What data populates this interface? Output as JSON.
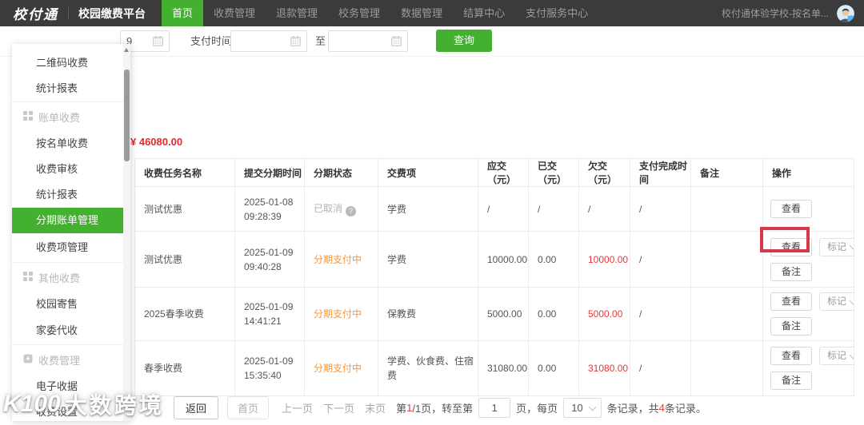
{
  "header": {
    "logo": "校付通",
    "title": "校园缴费平台",
    "nav": [
      {
        "label": "首页",
        "active": true
      },
      {
        "label": "收费管理"
      },
      {
        "label": "退款管理"
      },
      {
        "label": "校务管理"
      },
      {
        "label": "数据管理"
      },
      {
        "label": "结算中心"
      },
      {
        "label": "支付服务中心"
      }
    ],
    "school": "校付通体验学校-按名单..."
  },
  "sidebar": {
    "items": [
      {
        "label": "二维码收费",
        "type": "link"
      },
      {
        "label": "统计报表",
        "type": "link"
      },
      {
        "label": "账单收费",
        "type": "section"
      },
      {
        "label": "按名单收费",
        "type": "link"
      },
      {
        "label": "收费审核",
        "type": "link"
      },
      {
        "label": "统计报表",
        "type": "link"
      },
      {
        "label": "分期账单管理",
        "type": "link",
        "active": true
      },
      {
        "label": "收费项管理",
        "type": "link"
      },
      {
        "label": "其他收费",
        "type": "section"
      },
      {
        "label": "校园寄售",
        "type": "link"
      },
      {
        "label": "家委代收",
        "type": "link"
      },
      {
        "label": "收费管理",
        "type": "section"
      },
      {
        "label": "电子收据",
        "type": "link"
      },
      {
        "label": "收费设置",
        "type": "link"
      }
    ]
  },
  "filters": {
    "truncated_date_value": "9",
    "pay_time_label": "支付时间",
    "range_separator": "至",
    "query_button": "查询"
  },
  "summary": {
    "total_amount": "¥ 46080.00"
  },
  "table": {
    "columns": [
      "收费任务名称",
      "提交分期时间",
      "分期状态",
      "交费项",
      "应交（元）",
      "已交（元）",
      "欠交（元）",
      "支付完成时间",
      "备注",
      "操作"
    ],
    "rows": [
      {
        "name": "测试优惠",
        "submit_time": "2025-01-08 09:28:39",
        "status": "已取消",
        "status_type": "cancelled",
        "pay_items": "学费",
        "due": "/",
        "paid": "/",
        "owed": "/",
        "complete_time": "/",
        "remark": ""
      },
      {
        "name": "测试优惠",
        "submit_time": "2025-01-09 09:40:28",
        "status": "分期支付中",
        "status_type": "installment",
        "pay_items": "学费",
        "due": "10000.00",
        "paid": "0.00",
        "owed": "10000.00",
        "complete_time": "/",
        "remark": ""
      },
      {
        "name": "2025春季收费",
        "submit_time": "2025-01-09 14:41:21",
        "status": "分期支付中",
        "status_type": "installment",
        "pay_items": "保教费",
        "due": "5000.00",
        "paid": "0.00",
        "owed": "5000.00",
        "complete_time": "/",
        "remark": ""
      },
      {
        "name": "春季收费",
        "submit_time": "2025-01-09 15:35:40",
        "status": "分期支付中",
        "status_type": "installment",
        "pay_items": "学费、伙食费、住宿费",
        "due": "31080.00",
        "paid": "0.00",
        "owed": "31080.00",
        "complete_time": "/",
        "remark": ""
      }
    ],
    "action_labels": {
      "view": "查看",
      "mark": "标记",
      "remark": "备注"
    }
  },
  "pagination": {
    "back": "返回",
    "first": "首页",
    "prev": "上一页",
    "next": "下一页",
    "last": "末页",
    "page_prefix": "第",
    "current_page": "1",
    "page_total_suffix": "/1页，转至第",
    "goto_value": "1",
    "goto_suffix": "页，每页",
    "per_page": "10",
    "per_page_suffix": "条记录，共",
    "total_records": "4",
    "total_suffix": "条记录。"
  },
  "watermark": {
    "logo": "K100",
    "text": "大数跨境"
  },
  "colors": {
    "brand_green": "#44b030",
    "alert_red": "#e8383d",
    "status_orange": "#ff9434",
    "highlight_red": "#d5394a",
    "topbar_bg": "#3b3b3b"
  }
}
